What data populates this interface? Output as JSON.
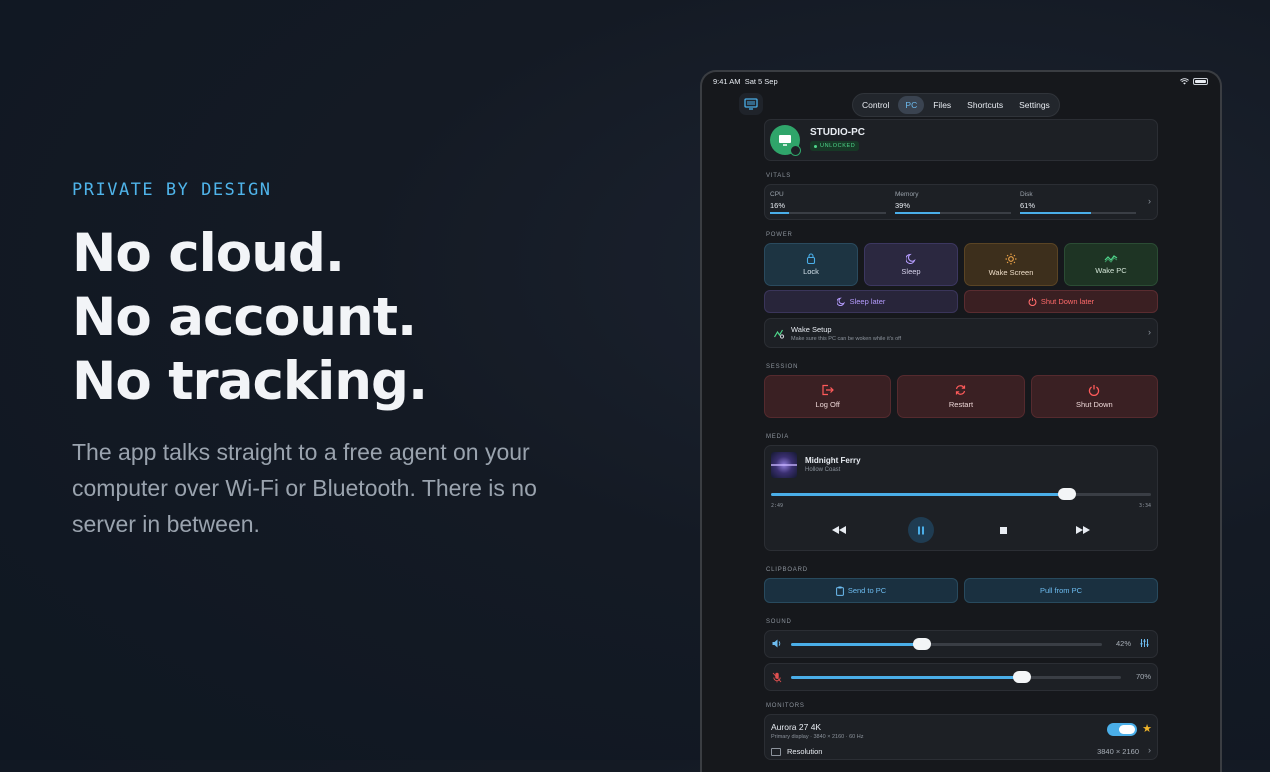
{
  "hero": {
    "eyebrow": "PRIVATE BY DESIGN",
    "line1": "No cloud.",
    "line2": "No account.",
    "line3": "No tracking.",
    "body": "The app talks straight to a free agent on your computer over Wi-Fi or Bluetooth. There is no server in between."
  },
  "statusbar": {
    "time": "9:41 AM",
    "date": "Sat 5 Sep"
  },
  "tabs": [
    {
      "label": "Control",
      "active": false
    },
    {
      "label": "PC",
      "active": true
    },
    {
      "label": "Files",
      "active": false
    },
    {
      "label": "Shortcuts",
      "active": false
    },
    {
      "label": "Settings",
      "active": false
    }
  ],
  "pc": {
    "name": "STUDIO-PC",
    "status": "UNLOCKED"
  },
  "vitals": {
    "label": "VITALS",
    "items": [
      {
        "label": "CPU",
        "value": "16%",
        "fraction": 0.16
      },
      {
        "label": "Memory",
        "value": "39%",
        "fraction": 0.39
      },
      {
        "label": "Disk",
        "value": "61%",
        "fraction": 0.61
      }
    ]
  },
  "power": {
    "label": "POWER",
    "lock": "Lock",
    "sleep": "Sleep",
    "wake_screen": "Wake Screen",
    "wake_pc": "Wake PC",
    "sleep_later": "Sleep later",
    "shutdown_later": "Shut Down later",
    "wake_setup_title": "Wake Setup",
    "wake_setup_sub": "Make sure this PC can be woken while it's off"
  },
  "session": {
    "label": "SESSION",
    "log_off": "Log Off",
    "restart": "Restart",
    "shut_down": "Shut Down"
  },
  "media": {
    "label": "MEDIA",
    "title": "Midnight Ferry",
    "artist": "Hollow Coast",
    "elapsed": "2:49",
    "duration": "3:34",
    "progress": 0.78
  },
  "clipboard": {
    "label": "CLIPBOARD",
    "send": "Send to PC",
    "pull": "Pull from PC"
  },
  "sound": {
    "label": "SOUND",
    "volume": {
      "value": "42%",
      "fraction": 0.42
    },
    "mic": {
      "value": "70%",
      "fraction": 0.7
    }
  },
  "monitors": {
    "label": "MONITORS",
    "name": "Aurora 27 4K",
    "sub": "Primary display · 3840 × 2160 · 60 Hz",
    "resolution_label": "Resolution",
    "resolution_value": "3840 × 2160"
  },
  "colors": {
    "accent": "#4aaee8",
    "unlocked": "#4fd68b",
    "danger": "#ff6a6a",
    "sleep": "#b59cff",
    "star": "#f0b429"
  }
}
